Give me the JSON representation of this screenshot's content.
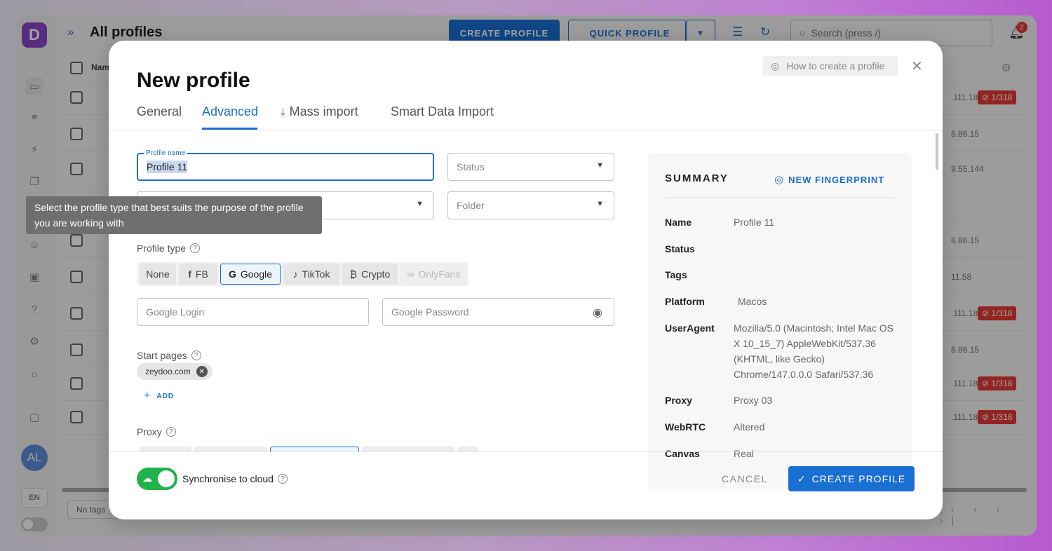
{
  "app": {
    "logo_letter": "D",
    "page_title": "All profiles",
    "create_profile_label": "CREATE PROFILE",
    "quick_profile_label": "QUICK PROFILE",
    "search_placeholder": "Search (press /)",
    "notification_count": "2",
    "list_header_name": "Nam",
    "avatar_initials": "AL",
    "language": "EN",
    "tags_filter": "No tags",
    "rows": [
      {
        "ip": ".111.186",
        "badge": "1/318"
      },
      {
        "ip": "6.86.15",
        "badge": ""
      },
      {
        "ip": "9.55.144",
        "badge": ""
      },
      {
        "ip": "",
        "badge": ""
      },
      {
        "ip": "6.86.15",
        "badge": ""
      },
      {
        "ip": "11.58",
        "badge": ""
      },
      {
        "ip": ".111.186",
        "badge": "1/318"
      },
      {
        "ip": "6.86.15",
        "badge": ""
      },
      {
        "ip": ".111.186",
        "badge": "1/318"
      },
      {
        "ip": ".111.186",
        "badge": "1/318"
      }
    ]
  },
  "modal": {
    "title": "New profile",
    "how_to_label": "How to create a profile",
    "tabs": [
      {
        "label": "General"
      },
      {
        "label": "Advanced"
      },
      {
        "label": "Mass import"
      },
      {
        "label": "Smart Data Import"
      }
    ],
    "profile_name_label": "Profile name",
    "profile_name_value": "Profile 11",
    "status_placeholder": "Status",
    "folder_placeholder": "Folder",
    "tooltip_text": "Select the profile type that best suits the purpose of the profile you are working with",
    "profile_type_label": "Profile type",
    "profile_types": [
      {
        "label": "None"
      },
      {
        "label": "FB"
      },
      {
        "label": "Google"
      },
      {
        "label": "TikTok"
      },
      {
        "label": "Crypto"
      },
      {
        "label": "OnlyFans"
      }
    ],
    "selected_profile_type": "Google",
    "google_login_placeholder": "Google Login",
    "google_password_placeholder": "Google Password",
    "start_pages_label": "Start pages",
    "start_page_chip": "zeydoo.com",
    "add_label": "ADD",
    "proxy_label": "Proxy",
    "sync_label": "Synchronise to cloud",
    "sync_enabled": true,
    "cancel_label": "CANCEL",
    "create_label": "CREATE PROFILE"
  },
  "summary": {
    "title": "SUMMARY",
    "new_fingerprint_label": "NEW FINGERPRINT",
    "items": [
      {
        "key": "Name",
        "value": "Profile 11"
      },
      {
        "key": "Status",
        "value": ""
      },
      {
        "key": "Tags",
        "value": ""
      },
      {
        "key": "Platform",
        "value": "Macos"
      },
      {
        "key": "UserAgent",
        "value": "Mozilla/5.0 (Macintosh; Intel Mac OS X 10_15_7) AppleWebKit/537.36 (KHTML, like Gecko) Chrome/147.0.0.0 Safari/537.36"
      },
      {
        "key": "Proxy",
        "value": "Proxy 03"
      },
      {
        "key": "WebRTC",
        "value": "Altered"
      },
      {
        "key": "Canvas",
        "value": "Real"
      }
    ]
  },
  "colors": {
    "accent": "#1a6fd3",
    "toggle_on": "#22b24c",
    "danger": "#e53935",
    "brand": "#8a46c9"
  }
}
